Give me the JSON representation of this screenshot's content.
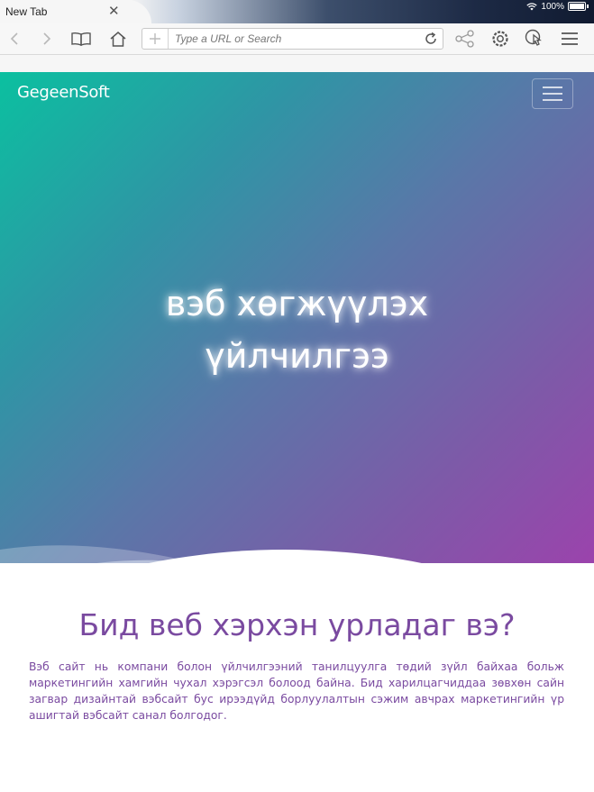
{
  "browser": {
    "tab_title": "New Tab",
    "tab_close": "✕",
    "battery": "100%",
    "url_placeholder": "Type a URL or Search",
    "icons": [
      "back-icon",
      "forward-icon",
      "bookmarks-icon",
      "home-icon",
      "new-tab-plus-icon",
      "reload-icon",
      "share-icon",
      "settings-icon",
      "gesture-icon",
      "menu-icon",
      "wifi-icon",
      "battery-icon"
    ]
  },
  "navbar": {
    "brand": "GegeenSoft"
  },
  "hero": {
    "title_line1": "вэб хөгжүүлэх",
    "title_line2": "үйлчилгээ"
  },
  "section": {
    "title": "Бид веб хэрхэн урладаг вэ?",
    "body": "Вэб сайт нь компани болон үйлчилгээний танилцуулга төдий зүйл байхаа больж маркетингийн хамгийн чухал хэрэгсэл болоод байна. Бид харилцагчиддаа зөвхөн сайн загвар дизайнтай вэбсайт бус ирээдүйд борлуулалтын сэжим авчрах маркетингийн үр ашигтай вэбсайт санал болгодог."
  },
  "colors": {
    "hero_start": "#0bc0a0",
    "hero_end": "#9b43ac",
    "section_text": "#7a4aa0"
  }
}
